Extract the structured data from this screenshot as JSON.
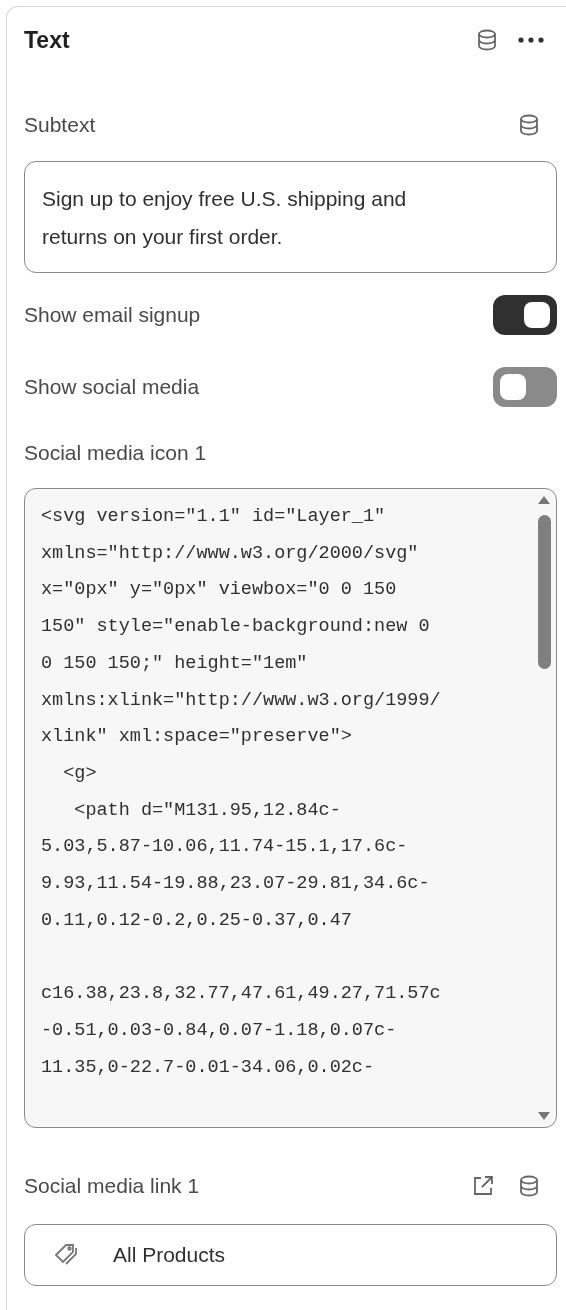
{
  "header": {
    "title": "Text"
  },
  "subtext": {
    "label": "Subtext",
    "value": "Sign up to enjoy free U.S. shipping and returns on your first order."
  },
  "toggles": [
    {
      "label": "Show email signup",
      "on": true
    },
    {
      "label": "Show social media",
      "on": false
    }
  ],
  "icon_field": {
    "label": "Social media icon 1",
    "value": "<svg version=\"1.1\" id=\"Layer_1\"\nxmlns=\"http://www.w3.org/2000/svg\"\nx=\"0px\" y=\"0px\" viewbox=\"0 0 150\n150\" style=\"enable-background:new 0\n0 150 150;\" height=\"1em\"\nxmlns:xlink=\"http://www.w3.org/1999/\nxlink\" xml:space=\"preserve\">\n  <g>\n   <path d=\"M131.95,12.84c-\n5.03,5.87-10.06,11.74-15.1,17.6c-\n9.93,11.54-19.88,23.07-29.81,34.6c-\n0.11,0.12-0.2,0.25-0.37,0.47\n\nc16.38,23.8,32.77,47.61,49.27,71.57c\n-0.51,0.03-0.84,0.07-1.18,0.07c-\n11.35,0-22.7-0.01-34.06,0.02c-"
  },
  "link_field": {
    "label": "Social media link 1",
    "value": "All Products"
  }
}
